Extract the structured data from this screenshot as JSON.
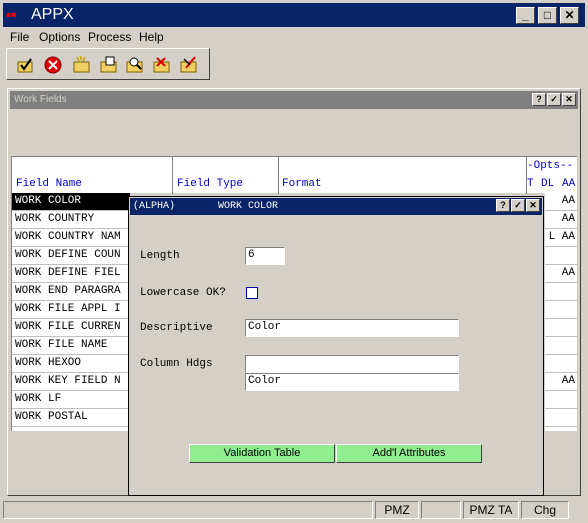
{
  "window": {
    "app_icon_text": "APPX",
    "title": "APPX"
  },
  "menu": [
    "File",
    "Options",
    "Process",
    "Help"
  ],
  "toolbar": {
    "icons": [
      "check-folder-icon",
      "cancel-icon",
      "new-folder-icon",
      "open-folder-icon",
      "search-folder-icon",
      "delete-folder-icon",
      "edit-folder-icon"
    ]
  },
  "work_fields": {
    "title": "Work Fields",
    "headers": {
      "field_name": "Field Name",
      "field_type": "Field Type",
      "format": "Format",
      "opts": "-Opts--",
      "t": "T",
      "dl": "DL",
      "aa": "AA"
    },
    "rows": [
      {
        "name": "WORK COLOR",
        "opts": "AA"
      },
      {
        "name": "WORK COUNTRY",
        "opts": "AA"
      },
      {
        "name": "WORK COUNTRY NAM",
        "opts": "L AA"
      },
      {
        "name": "WORK DEFINE COUN",
        "opts": ""
      },
      {
        "name": "WORK DEFINE FIEL",
        "opts": "AA"
      },
      {
        "name": "WORK END PARAGRA",
        "opts": ""
      },
      {
        "name": "WORK FILE APPL I",
        "opts": ""
      },
      {
        "name": "WORK FILE CURREN",
        "opts": ""
      },
      {
        "name": "WORK FILE NAME",
        "opts": ""
      },
      {
        "name": "WORK HEXOO",
        "opts": ""
      },
      {
        "name": "WORK KEY FIELD N",
        "opts": "AA"
      },
      {
        "name": "WORK LF",
        "opts": ""
      },
      {
        "name": "WORK POSTAL",
        "opts": ""
      }
    ]
  },
  "dialog": {
    "type": "(ALPHA)",
    "name": "WORK COLOR",
    "length_label": "Length",
    "length_value": "6",
    "lowercase_label": "Lowercase OK?",
    "descriptive_label": "Descriptive",
    "descriptive_value": "Color",
    "column_hdgs_label": "Column Hdgs",
    "column_hdg_1": "",
    "column_hdg_2": "Color",
    "validation_button": "Validation Table",
    "attributes_button": "Add'l Attributes"
  },
  "status": {
    "s1": "PMZ",
    "s2": "PMZ TA",
    "s3": "Chg"
  },
  "colors": {
    "title_active": "#0a246a",
    "title_inactive": "#808080",
    "button_green": "#90ee90",
    "header_text": "#0000cc"
  }
}
